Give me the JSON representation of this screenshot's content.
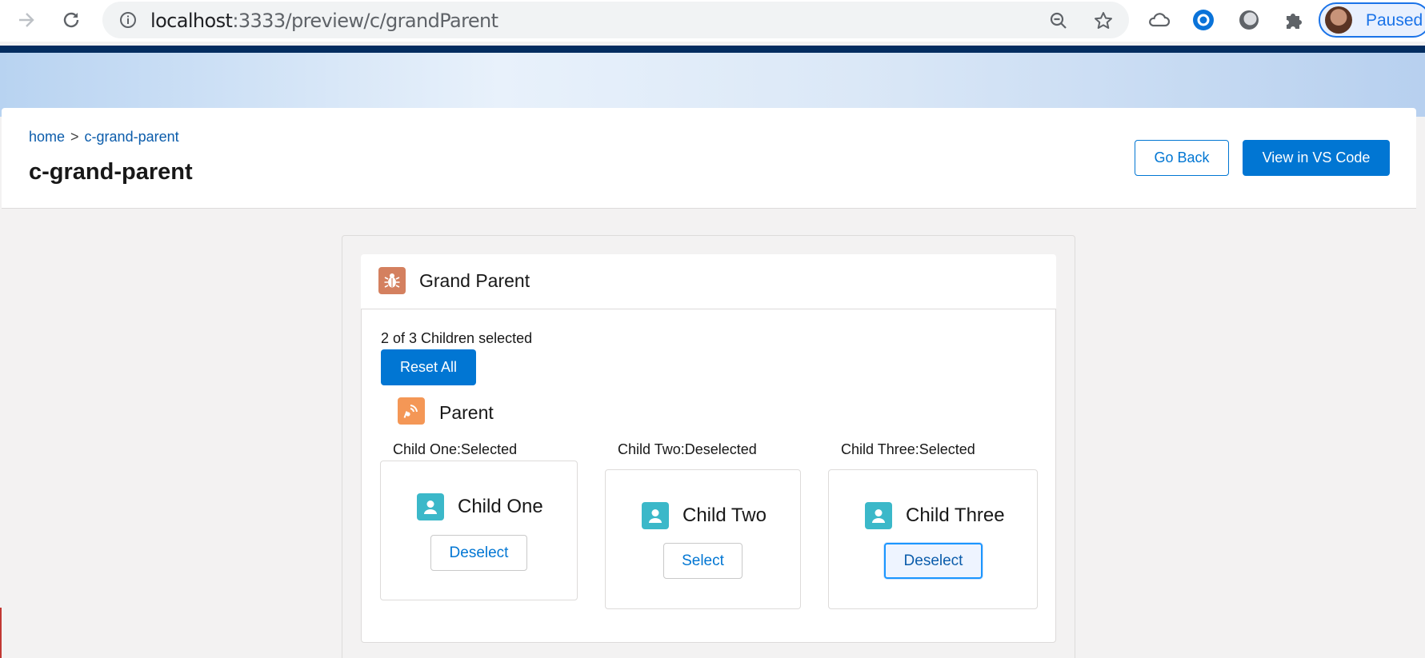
{
  "browser": {
    "url_host": "localhost",
    "url_path": ":3333/preview/c/grandParent",
    "profile_status": "Paused"
  },
  "header": {
    "breadcrumb": {
      "home": "home",
      "separator": ">",
      "current": "c-grand-parent"
    },
    "title": "c-grand-parent",
    "go_back_label": "Go Back",
    "vscode_label": "View in VS Code"
  },
  "grand_parent": {
    "title": "Grand Parent",
    "selection_summary": "2 of 3 Children selected",
    "reset_label": "Reset All"
  },
  "parent": {
    "title": "Parent"
  },
  "children": [
    {
      "status_label": "Child One:Selected",
      "name": "Child One",
      "button_label": "Deselect"
    },
    {
      "status_label": "Child Two:Deselected",
      "name": "Child Two",
      "button_label": "Select"
    },
    {
      "status_label": "Child Three:Selected",
      "name": "Child Three",
      "button_label": "Deselect"
    }
  ],
  "colors": {
    "brand": "#0176d3",
    "grand_parent_icon": "#d4805f",
    "parent_icon": "#f49756",
    "child_icon": "#3bb8c9"
  },
  "icons": {
    "grand_parent": "bug-icon",
    "parent": "broadcast-icon",
    "child": "user-icon"
  }
}
